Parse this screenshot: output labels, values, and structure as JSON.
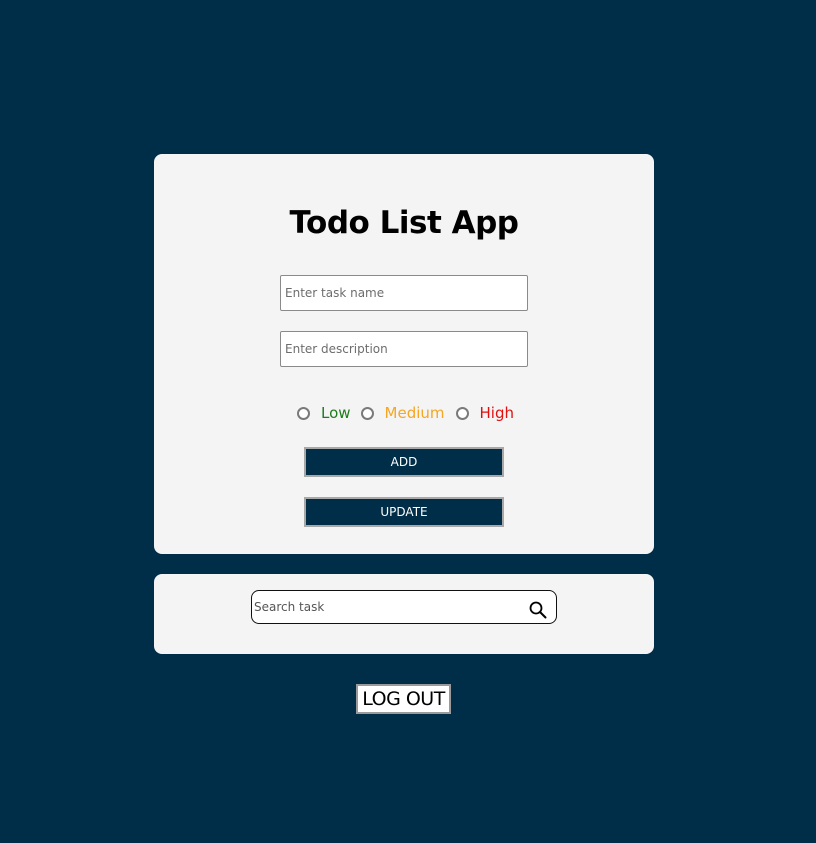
{
  "app": {
    "title": "Todo List App"
  },
  "form": {
    "task_name": {
      "value": "",
      "placeholder": "Enter task name"
    },
    "description": {
      "value": "",
      "placeholder": "Enter description"
    },
    "priority": {
      "options": [
        {
          "label": "Low",
          "color": "#1c7d1c",
          "checked": false
        },
        {
          "label": "Medium",
          "color": "#f5a623",
          "checked": false
        },
        {
          "label": "High",
          "color": "#e01010",
          "checked": false
        }
      ]
    },
    "add_label": "ADD",
    "update_label": "UPDATE"
  },
  "search": {
    "value": "",
    "placeholder": "Search task",
    "icon": "search-icon"
  },
  "logout_label": "LOG OUT",
  "colors": {
    "background": "#002d48",
    "card": "#f4f4f4",
    "button": "#002d48"
  }
}
